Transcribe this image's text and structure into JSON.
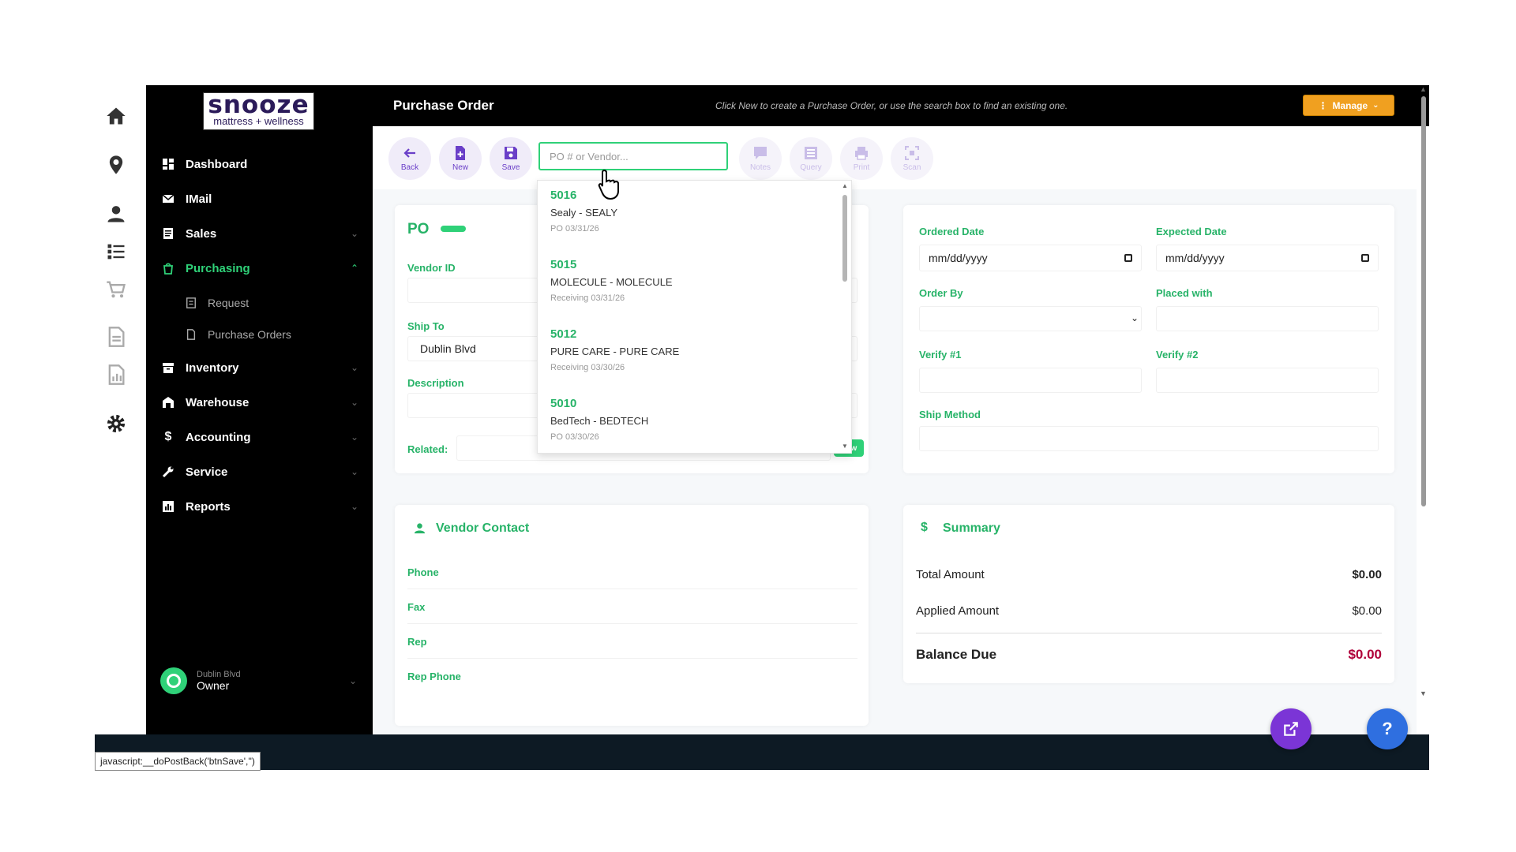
{
  "brand": {
    "name": "snooze",
    "tagline": "mattress + wellness"
  },
  "sidebar": {
    "items": [
      {
        "label": "Dashboard"
      },
      {
        "label": "IMail"
      },
      {
        "label": "Sales"
      },
      {
        "label": "Purchasing"
      },
      {
        "label": "Inventory"
      },
      {
        "label": "Warehouse"
      },
      {
        "label": "Accounting"
      },
      {
        "label": "Service"
      },
      {
        "label": "Reports"
      }
    ],
    "subitems": [
      {
        "label": "Request"
      },
      {
        "label": "Purchase Orders"
      }
    ],
    "user": {
      "location": "Dublin Blvd",
      "role": "Owner"
    }
  },
  "header": {
    "title": "Purchase Order",
    "hint": "Click New to create a Purchase Order, or use the search box to find an existing one.",
    "manage_label": "Manage"
  },
  "toolbar": {
    "back": "Back",
    "new": "New",
    "save": "Save",
    "search_placeholder": "PO # or Vendor...",
    "notes": "Notes",
    "query": "Query",
    "print": "Print",
    "scan": "Scan"
  },
  "po_card": {
    "title": "PO",
    "vendor_id_label": "Vendor ID",
    "ship_to_label": "Ship To",
    "ship_to_value": "Dublin Blvd",
    "description_label": "Description",
    "related_label": "Related:",
    "new_button": "New"
  },
  "dates_card": {
    "ordered_date_label": "Ordered Date",
    "ordered_date_value": "mm/dd/yyyy",
    "expected_date_label": "Expected Date",
    "expected_date_value": "mm/dd/yyyy",
    "order_by_label": "Order By",
    "placed_with_label": "Placed with",
    "verify1_label": "Verify #1",
    "verify2_label": "Verify #2",
    "ship_method_label": "Ship Method"
  },
  "search_results": [
    {
      "number": "5016",
      "vendor": "Sealy - SEALY",
      "status": "PO 03/31/26"
    },
    {
      "number": "5015",
      "vendor": "MOLECULE - MOLECULE",
      "status": "Receiving 03/31/26"
    },
    {
      "number": "5012",
      "vendor": "PURE CARE - PURE CARE",
      "status": "Receiving 03/30/26"
    },
    {
      "number": "5010",
      "vendor": "BedTech - BEDTECH",
      "status": "PO 03/30/26"
    }
  ],
  "vendor_contact": {
    "title": "Vendor Contact",
    "phone_label": "Phone",
    "fax_label": "Fax",
    "rep_label": "Rep",
    "rep_phone_label": "Rep Phone"
  },
  "summary": {
    "title": "Summary",
    "total_label": "Total Amount",
    "total_value": "$0.00",
    "applied_label": "Applied Amount",
    "applied_value": "$0.00",
    "balance_label": "Balance Due",
    "balance_value": "$0.00"
  },
  "status_bar": {
    "text": "javascript:__doPostBack('btnSave','')"
  },
  "fabs": {
    "help": "?"
  },
  "colors": {
    "accent_green": "#2fd178",
    "toolbar_purple": "#6a3fc8",
    "manage_orange": "#f0a020",
    "balance_red": "#b0003a",
    "fab_purple": "#7b35d6",
    "fab_blue": "#2f6fe0"
  },
  "icons": {
    "rail": [
      "home-icon",
      "location-pin-icon",
      "user-icon",
      "checklist-icon",
      "cart-icon",
      "document-icon",
      "report-icon",
      "gear-icon"
    ]
  }
}
